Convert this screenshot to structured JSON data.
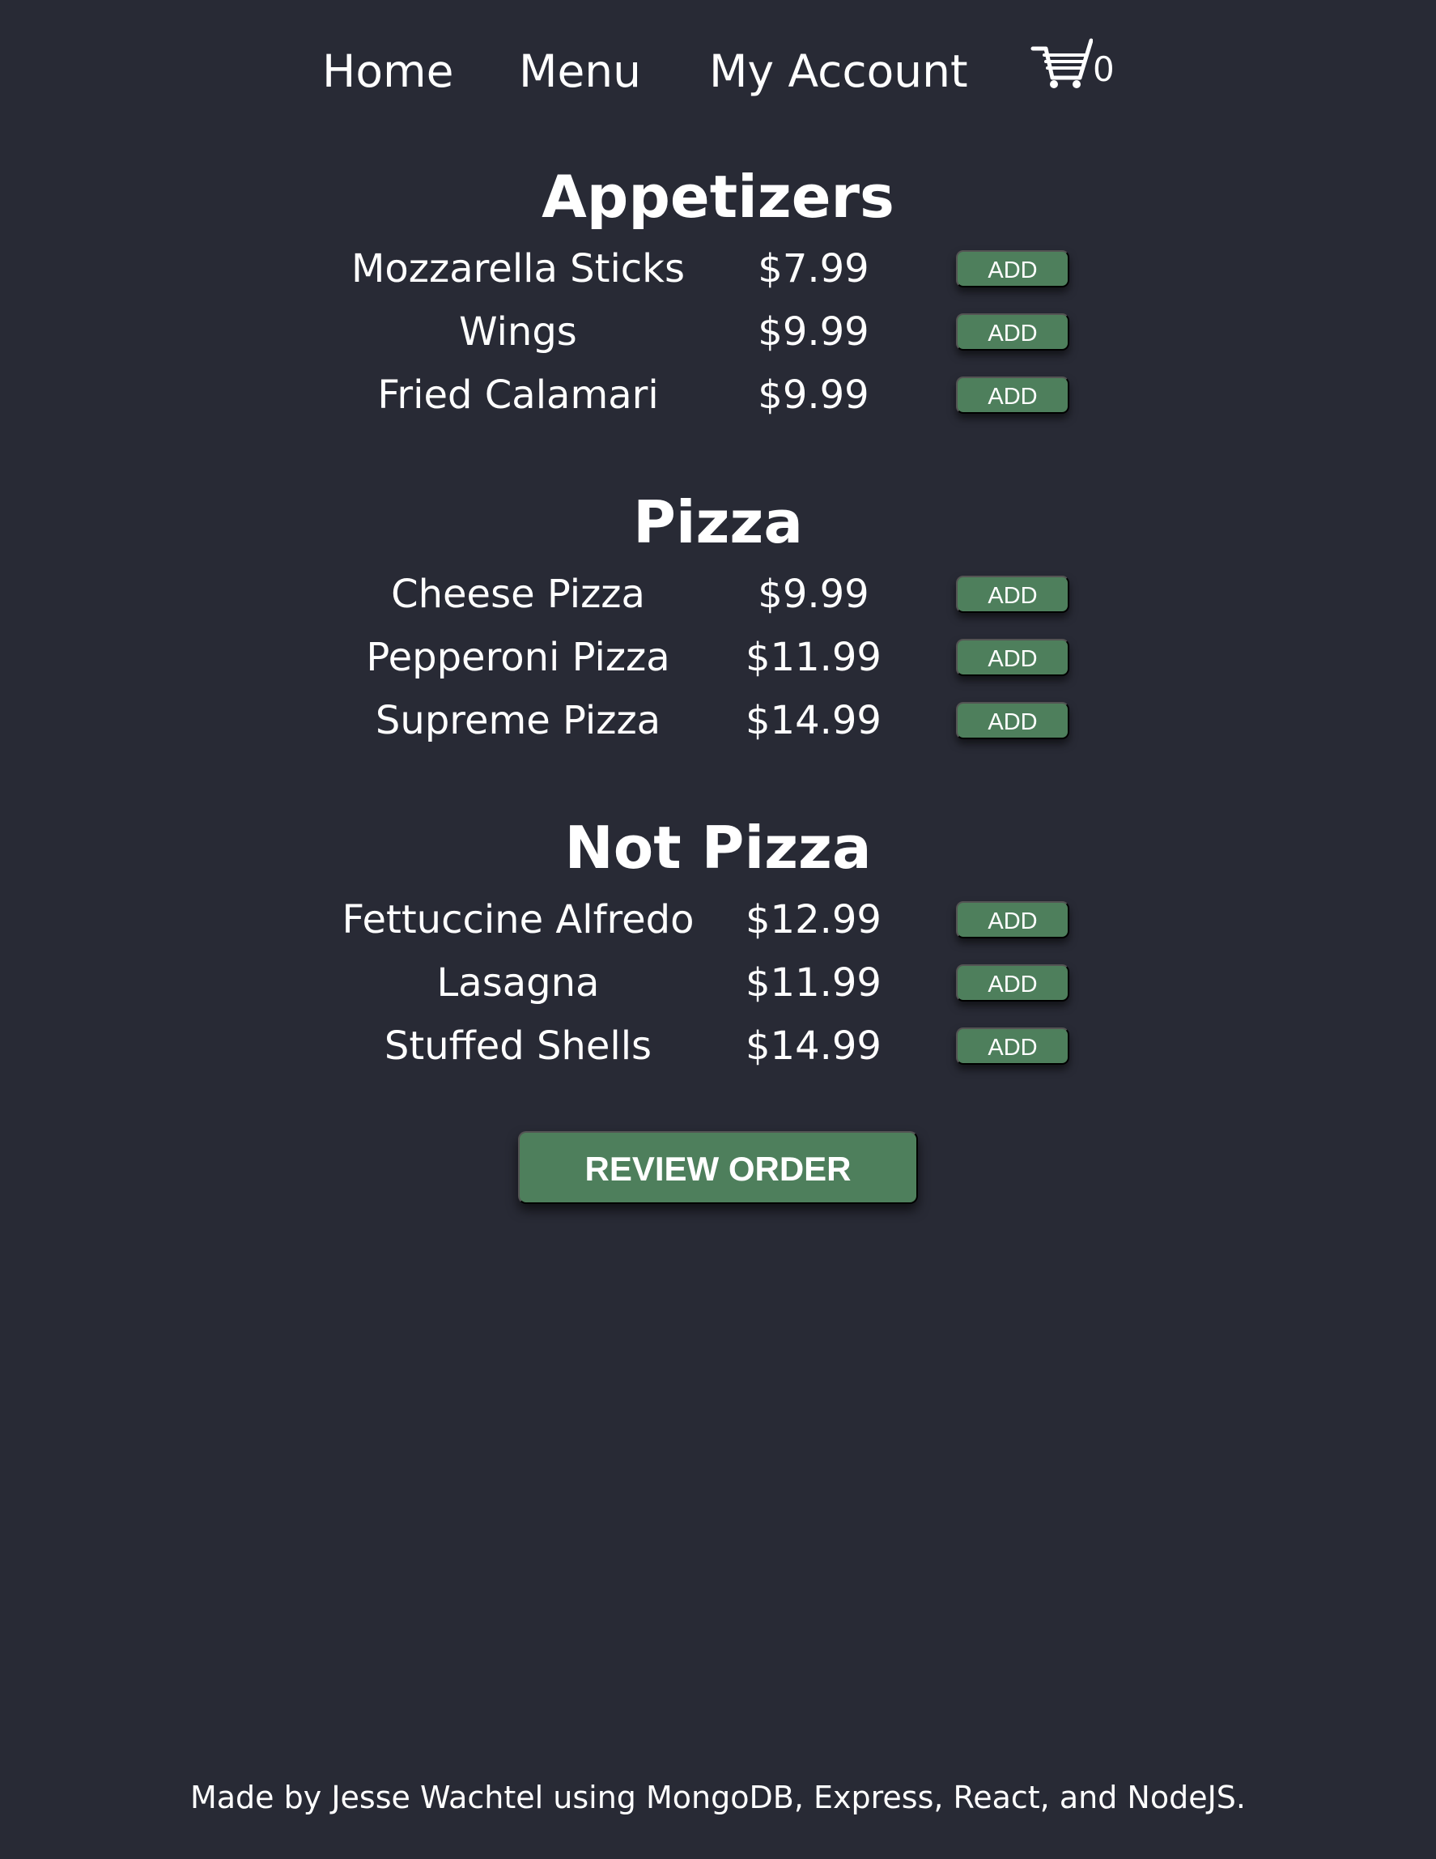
{
  "nav": {
    "home": "Home",
    "menu": "Menu",
    "account": "My Account",
    "cart_icon": "shopping-cart-icon",
    "cart_count": "0"
  },
  "sections": [
    {
      "title": "Appetizers",
      "items": [
        {
          "name": "Mozzarella Sticks",
          "price": "$7.99",
          "button": "ADD"
        },
        {
          "name": "Wings",
          "price": "$9.99",
          "button": "ADD"
        },
        {
          "name": "Fried Calamari",
          "price": "$9.99",
          "button": "ADD"
        }
      ]
    },
    {
      "title": "Pizza",
      "items": [
        {
          "name": "Cheese Pizza",
          "price": "$9.99",
          "button": "ADD"
        },
        {
          "name": "Pepperoni Pizza",
          "price": "$11.99",
          "button": "ADD"
        },
        {
          "name": "Supreme Pizza",
          "price": "$14.99",
          "button": "ADD"
        }
      ]
    },
    {
      "title": "Not Pizza",
      "items": [
        {
          "name": "Fettuccine Alfredo",
          "price": "$12.99",
          "button": "ADD"
        },
        {
          "name": "Lasagna",
          "price": "$11.99",
          "button": "ADD"
        },
        {
          "name": "Stuffed Shells",
          "price": "$14.99",
          "button": "ADD"
        }
      ]
    }
  ],
  "review_button": "REVIEW ORDER",
  "footer": "Made by Jesse Wachtel using MongoDB, Express, React, and NodeJS.",
  "colors": {
    "background": "#282a35",
    "button": "#4e7f5c",
    "text": "#ffffff"
  }
}
